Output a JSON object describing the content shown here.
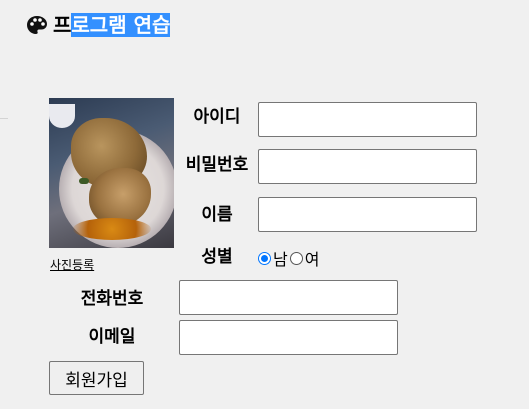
{
  "header": {
    "icon": "palette-icon",
    "title_prefix": "프",
    "title_selected": "로그램 연습"
  },
  "photo": {
    "link_label": "사진등록"
  },
  "form": {
    "id_label": "아이디",
    "id_value": "",
    "pw_label": "비밀번호",
    "pw_value": "",
    "name_label": "이름",
    "name_value": "",
    "gender_label": "성별",
    "gender_options": [
      "남",
      "여"
    ],
    "gender_selected": "남",
    "phone_label": "전화번호",
    "phone_value": "",
    "email_label": "이메일",
    "email_value": "",
    "submit_label": "회원가입"
  },
  "colors": {
    "background": "#f0f0f0",
    "selection": "#3390ff",
    "radio_accent": "#0075ff"
  }
}
